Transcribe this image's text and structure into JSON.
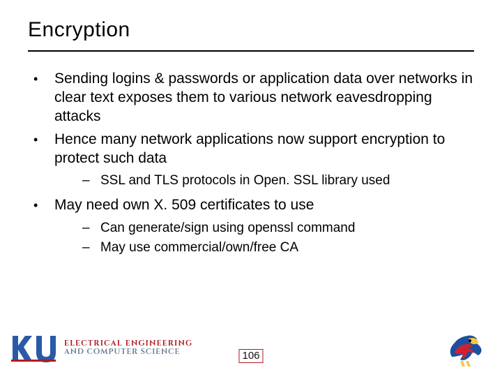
{
  "title": "Encryption",
  "bullets": [
    {
      "text": "Sending logins & passwords or application data over networks in clear text exposes them to various network eavesdropping attacks"
    },
    {
      "text": "Hence many network applications now support encryption to protect such data",
      "subs": [
        "SSL and TLS protocols in Open. SSL library used"
      ]
    },
    {
      "text": "May need own X. 509 certificates to use",
      "subs": [
        "Can generate/sign using openssl command",
        "May use commercial/own/free CA"
      ]
    }
  ],
  "footer": {
    "dept_line1": "ELECTRICAL ENGINEERING",
    "dept_line2": "AND COMPUTER SCIENCE",
    "page_number": "106"
  }
}
